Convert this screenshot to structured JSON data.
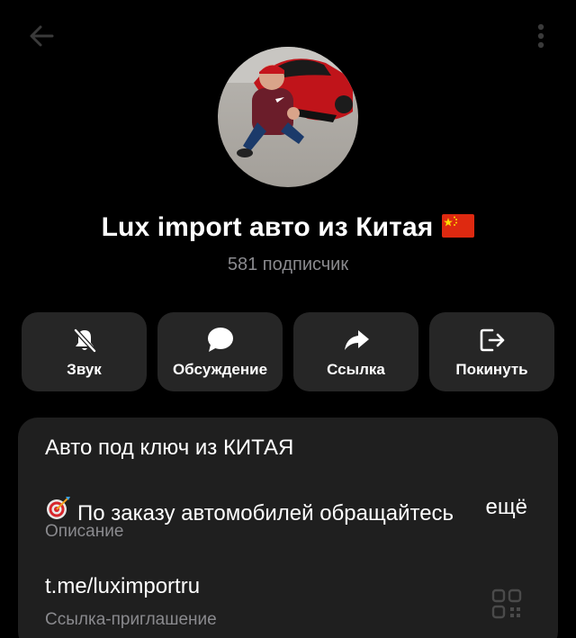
{
  "header": {
    "back_icon": "arrow-left-icon",
    "more_icon": "more-vertical-icon"
  },
  "profile": {
    "title": "Lux import авто из Китая",
    "flag_icon": "china-flag-icon",
    "subscribers": "581 подписчик"
  },
  "actions": [
    {
      "label": "Звук",
      "icon": "bell-off-icon"
    },
    {
      "label": "Обсуждение",
      "icon": "chat-bubble-icon"
    },
    {
      "label": "Ссылка",
      "icon": "share-arrow-icon"
    },
    {
      "label": "Покинуть",
      "icon": "leave-icon"
    }
  ],
  "info": {
    "description_line1": "Авто под ключ из КИТАЯ",
    "description_line2": "По заказу автомобилей обращайтесь",
    "description_more": "ещё",
    "description_caption": "Описание",
    "invite_link": "t.me/luximportru",
    "invite_caption": "Ссылка-приглашение",
    "qr_icon": "qr-code-icon"
  },
  "colors": {
    "background": "#000000",
    "button_bg": "#262626",
    "card_bg": "#1f1f1f",
    "secondary_text": "#8a8a8e"
  }
}
